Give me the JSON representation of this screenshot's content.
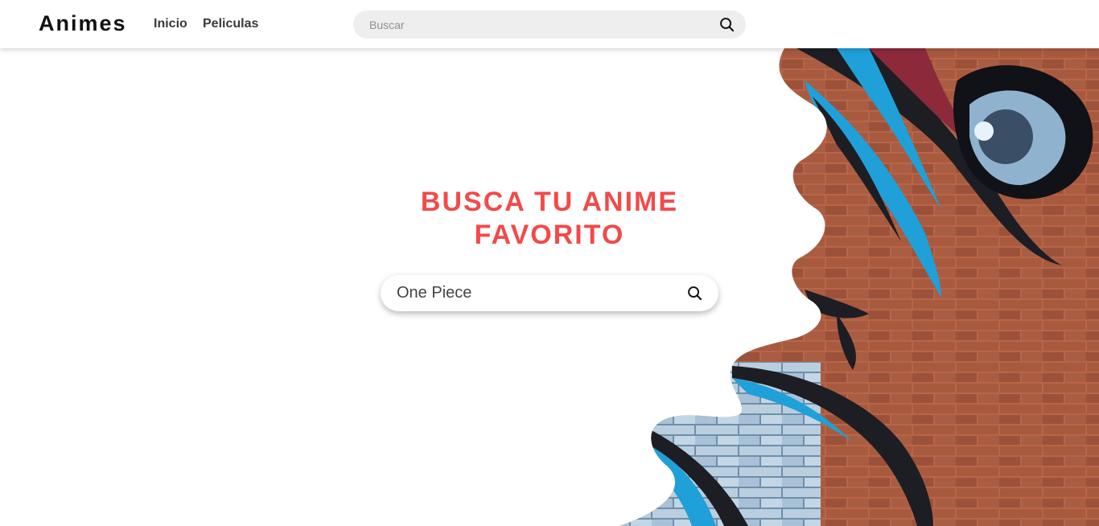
{
  "brand": {
    "name": "Animes"
  },
  "nav": {
    "items": [
      {
        "label": "Inicio"
      },
      {
        "label": "Peliculas"
      }
    ]
  },
  "top_search": {
    "placeholder": "Buscar",
    "icon": "search-icon"
  },
  "hero": {
    "title": "BUSCA TU ANIME FAVORITO",
    "search": {
      "value": "One Piece",
      "icon": "search-icon"
    },
    "art": "anime-eye-brick-wall-mural"
  },
  "colors": {
    "accent": "#f24a4a",
    "brick": "#a35a40",
    "mural_blue": "#1fa0d8",
    "navbar_search_bg": "#eeeeee"
  }
}
